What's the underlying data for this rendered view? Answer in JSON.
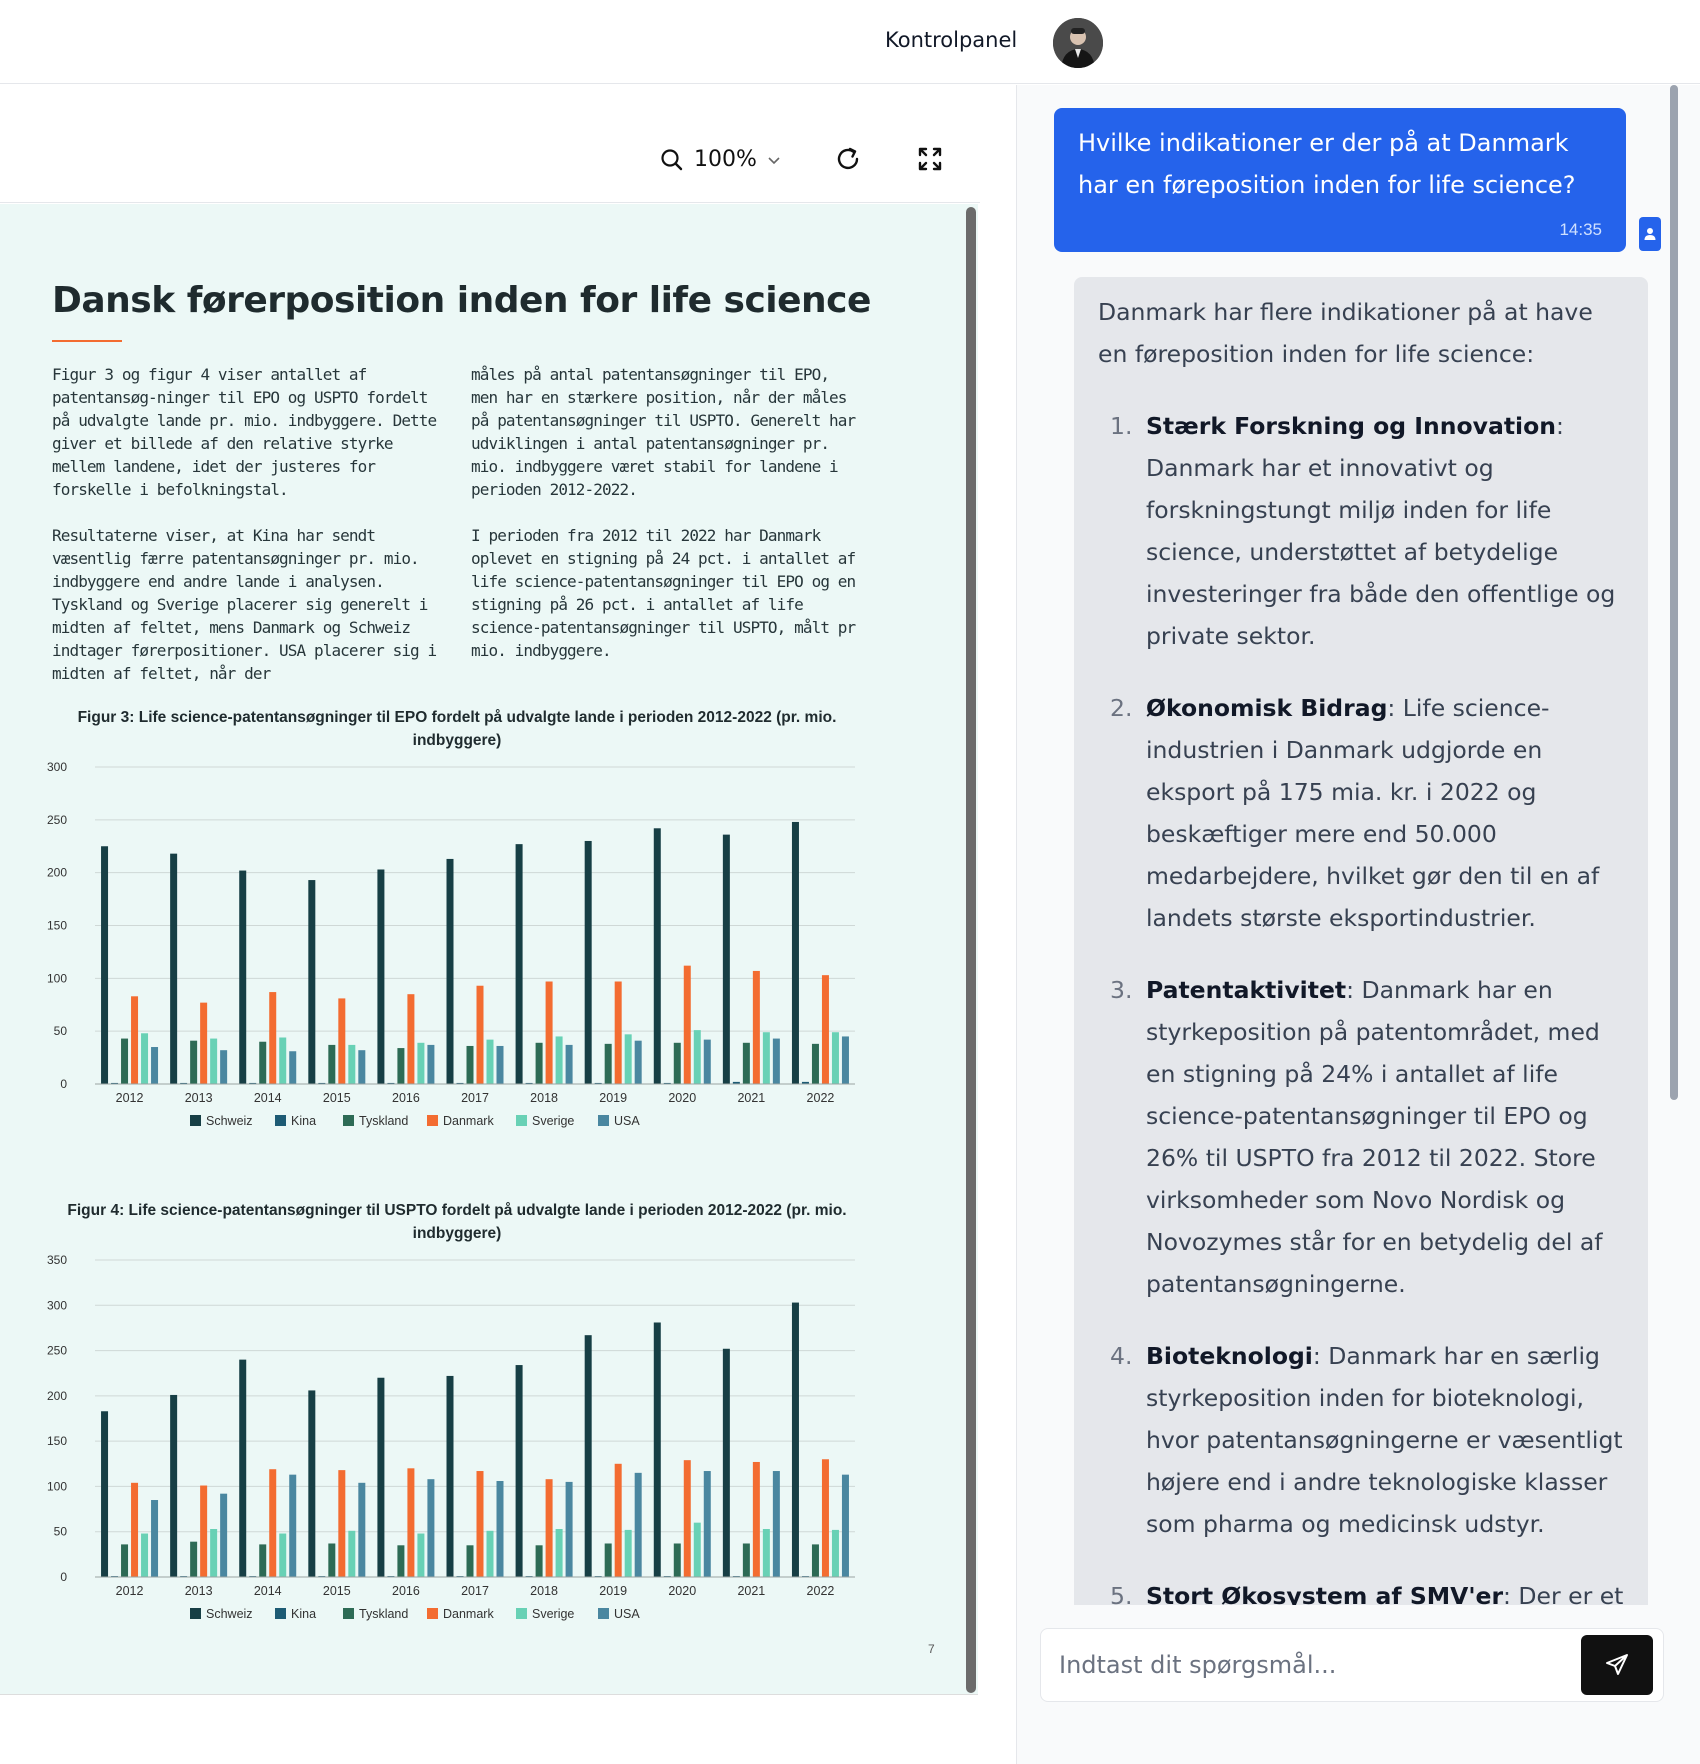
{
  "header": {
    "nav_label": "Kontrolpanel"
  },
  "toolbar": {
    "zoom": "100%"
  },
  "document": {
    "title": "Dansk førerposition inden for life science",
    "col1": [
      "Figur 3 og figur 4 viser antallet af patentansøg-ninger til EPO og USPTO fordelt på udvalgte lande pr. mio. indbyggere. Dette giver et billede af den relative styrke mellem landene, idet der justeres for forskelle i befolkningstal.",
      "Resultaterne viser, at Kina har sendt væsentlig færre patentansøgninger pr. mio. indbyggere end andre lande i analysen. Tyskland og Sverige placerer sig generelt i midten af feltet, mens Danmark og Schweiz indtager førerpositioner. USA placerer sig i midten af feltet, når der"
    ],
    "col2": [
      "måles på antal patentansøgninger til EPO, men har en stærkere position, når der måles på patentansøgninger til USPTO. Generelt har udviklingen i antal patentansøgninger pr. mio. indbyggere været stabil for landene i perioden 2012-2022.",
      "I perioden fra 2012 til 2022 har Danmark oplevet en stigning på 24 pct. i antallet af life science-patentansøgninger til EPO og en stigning på 26 pct. i antallet af life science-patentansøgninger til USPTO, målt pr mio. indbyggere."
    ],
    "page_number": "7"
  },
  "chart_data": [
    {
      "type": "bar",
      "title": "Figur 3: Life science-patentansøgninger til EPO fordelt på udvalgte lande i perioden 2012-2022 (pr. mio. indbyggere)",
      "categories": [
        "2012",
        "2013",
        "2014",
        "2015",
        "2016",
        "2017",
        "2018",
        "2019",
        "2020",
        "2021",
        "2022"
      ],
      "ylim": [
        0,
        300
      ],
      "yticks": [
        0,
        50,
        100,
        150,
        200,
        250,
        300
      ],
      "grid": true,
      "legend_position": "bottom",
      "series": [
        {
          "name": "Schweiz",
          "color": "#173f45",
          "values": [
            225,
            218,
            202,
            193,
            203,
            213,
            227,
            230,
            242,
            236,
            248
          ]
        },
        {
          "name": "Kina",
          "color": "#1d5b74",
          "values": [
            1,
            1,
            1,
            1,
            1,
            1,
            1,
            1,
            1,
            2,
            2
          ]
        },
        {
          "name": "Tyskland",
          "color": "#2d6b55",
          "values": [
            43,
            41,
            40,
            37,
            34,
            36,
            39,
            38,
            39,
            39,
            38
          ]
        },
        {
          "name": "Danmark",
          "color": "#f36c31",
          "values": [
            83,
            77,
            87,
            81,
            85,
            93,
            97,
            97,
            112,
            107,
            103
          ]
        },
        {
          "name": "Sverige",
          "color": "#68d1b5",
          "values": [
            48,
            43,
            44,
            37,
            39,
            42,
            45,
            47,
            51,
            49,
            49
          ]
        },
        {
          "name": "USA",
          "color": "#4a87a0",
          "values": [
            35,
            32,
            31,
            32,
            37,
            36,
            37,
            41,
            42,
            43,
            45
          ]
        }
      ]
    },
    {
      "type": "bar",
      "title": "Figur 4: Life science-patentansøgninger til USPTO fordelt på udvalgte lande i perioden 2012-2022 (pr. mio. indbyggere)",
      "categories": [
        "2012",
        "2013",
        "2014",
        "2015",
        "2016",
        "2017",
        "2018",
        "2019",
        "2020",
        "2021",
        "2022"
      ],
      "ylim": [
        0,
        350
      ],
      "yticks": [
        0,
        50,
        100,
        150,
        200,
        250,
        300,
        350
      ],
      "grid": true,
      "legend_position": "bottom",
      "series": [
        {
          "name": "Schweiz",
          "color": "#173f45",
          "values": [
            183,
            201,
            240,
            206,
            220,
            222,
            234,
            267,
            281,
            252,
            303
          ]
        },
        {
          "name": "Kina",
          "color": "#1d5b74",
          "values": [
            1,
            1,
            1,
            1,
            1,
            1,
            1,
            1,
            1,
            1,
            1
          ]
        },
        {
          "name": "Tyskland",
          "color": "#2d6b55",
          "values": [
            36,
            39,
            36,
            37,
            35,
            35,
            35,
            37,
            37,
            37,
            36
          ]
        },
        {
          "name": "Danmark",
          "color": "#f36c31",
          "values": [
            104,
            101,
            119,
            118,
            120,
            117,
            108,
            125,
            129,
            127,
            130
          ]
        },
        {
          "name": "Sverige",
          "color": "#68d1b5",
          "values": [
            48,
            53,
            48,
            51,
            48,
            51,
            53,
            52,
            60,
            53,
            52
          ]
        },
        {
          "name": "USA",
          "color": "#4a87a0",
          "values": [
            85,
            92,
            113,
            104,
            108,
            106,
            105,
            115,
            117,
            117,
            113
          ]
        }
      ]
    }
  ],
  "chat": {
    "user_message": "Hvilke indikationer er der på at Danmark har en føreposition inden for life science?",
    "user_time": "14:35",
    "assistant_intro": "Danmark har flere indikationer på at have en føreposition inden for life science:",
    "items": [
      {
        "num": "1.",
        "title": "Stærk Forskning og Innovation",
        "text": ": Danmark har et innovativt og forskningstungt miljø inden for life science, understøttet af betydelige investeringer fra både den offentlige og private sektor."
      },
      {
        "num": "2.",
        "title": "Økonomisk Bidrag",
        "text": ": Life science-industrien i Danmark udgjorde en eksport på 175 mia. kr. i 2022 og beskæftiger mere end 50.000 medarbejdere, hvilket gør den til en af landets største eksportindustrier."
      },
      {
        "num": "3.",
        "title": "Patentaktivitet",
        "text": ": Danmark har en styrkeposition på patentområdet, med en stigning på 24% i antallet af life science-patentansøgninger til EPO og 26% til USPTO fra 2012 til 2022. Store virksomheder som Novo Nordisk og Novozymes står for en betydelig del af patentansøgningerne."
      },
      {
        "num": "4.",
        "title": "Bioteknologi",
        "text": ": Danmark har en særlig styrkeposition inden for bioteknologi, hvor patentansøgningerne er væsentligt højere end i andre teknologiske klasser som pharma og medicinsk udstyr."
      },
      {
        "num": "5.",
        "title": "Stort Økosystem af SMV'er",
        "text": ": Der er et stort økosystem af små og mellemstore"
      }
    ],
    "input_placeholder": "Indtast dit spørgsmål..."
  },
  "icons": {
    "zoom": "search-icon",
    "refresh": "refresh-icon",
    "fullscreen": "expand-icon",
    "send": "send-icon",
    "user": "user-icon"
  }
}
